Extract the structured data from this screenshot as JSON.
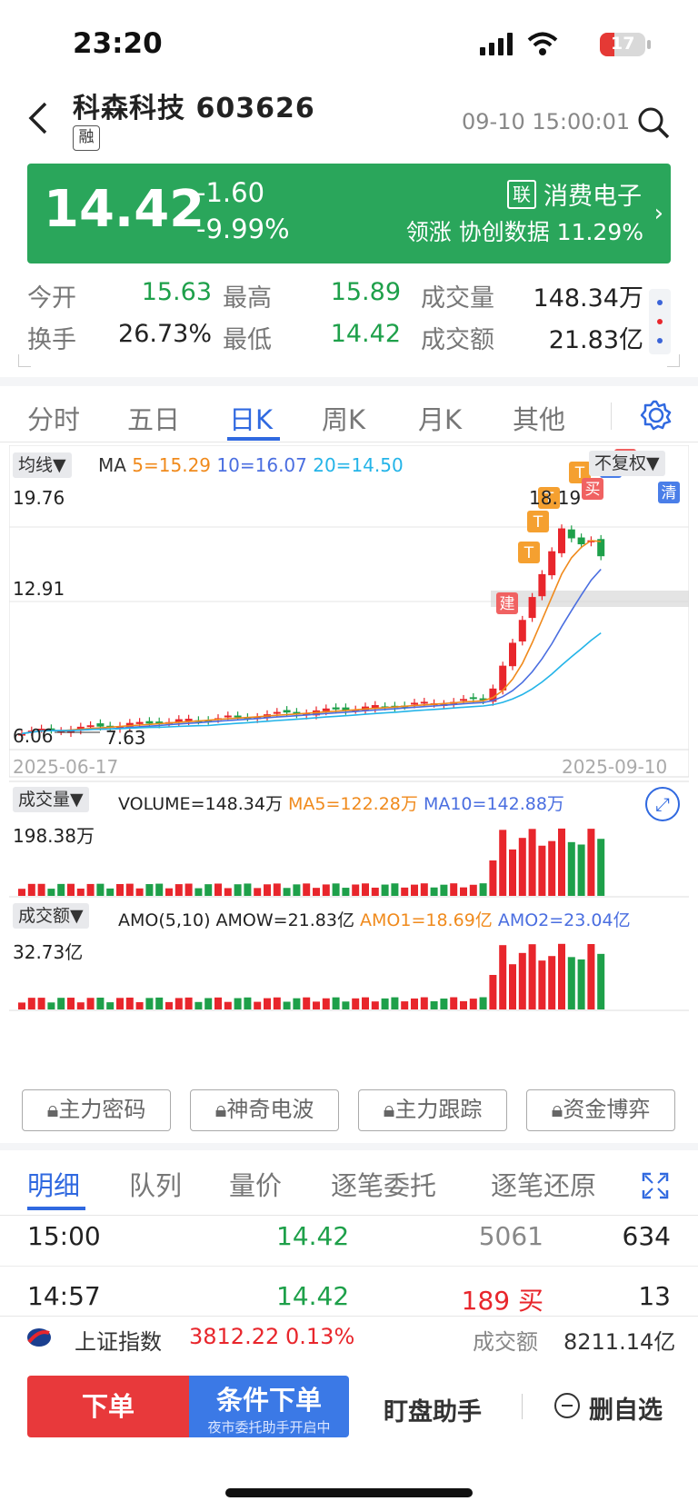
{
  "status": {
    "time": "23:20",
    "battery": "17"
  },
  "header": {
    "stock_name": "科森科技",
    "stock_code": "603626",
    "margin_tag": "融",
    "datetime": "09-10 15:00:01"
  },
  "banner": {
    "price": "14.42",
    "change": "-1.60",
    "change_pct": "-9.99%",
    "linked_tag": "联",
    "sector": "消费电子",
    "lead_label": "领涨",
    "lead_stock": "协创数据",
    "lead_pct": "11.29%",
    "color": "#2aa65b"
  },
  "stats": {
    "open_label": "今开",
    "open": "15.63",
    "high_label": "最高",
    "high": "15.89",
    "volume_label": "成交量",
    "volume": "148.34万",
    "turnover_label": "换手",
    "turnover": "26.73%",
    "low_label": "最低",
    "low": "14.42",
    "amount_label": "成交额",
    "amount": "21.83亿"
  },
  "tabs": [
    "分时",
    "五日",
    "日K",
    "周K",
    "月K",
    "其他"
  ],
  "active_tab": "日K",
  "kchart": {
    "ma_chip": "均线▼",
    "ma_label": "MA",
    "ma5": "5=15.29",
    "ma10": "10=16.07",
    "ma20": "20=14.50",
    "adjust_chip": "不复权▼",
    "y_top": "19.76",
    "y_mid": "12.91",
    "low_label": "6.06",
    "low_label2": "7.63",
    "high_label": "18.19",
    "date_start": "2025-06-17",
    "date_end": "2025-09-10",
    "markers": {
      "build": "建",
      "trade": "T",
      "buy": "买",
      "clear": "清"
    },
    "colors": {
      "up": "#e8262c",
      "down": "#1ea04a",
      "ma5": "#f08a1c",
      "ma10": "#4a6ee0",
      "ma20": "#24b4e8"
    }
  },
  "volume_panel": {
    "chip": "成交量▼",
    "label": "VOLUME=148.34万",
    "ma5": "MA5=122.28万",
    "ma10": "MA10=142.88万",
    "max": "198.38万"
  },
  "amount_panel": {
    "chip": "成交额▼",
    "label": "AMO(5,10)",
    "amow": "AMOW=21.83亿",
    "amo1": "AMO1=18.69亿",
    "amo2": "AMO2=23.04亿",
    "max": "32.73亿"
  },
  "tools": [
    "主力密码",
    "神奇电波",
    "主力跟踪",
    "资金博弈"
  ],
  "detail_tabs": [
    "明细",
    "队列",
    "量价",
    "逐笔委托",
    "逐笔还原"
  ],
  "detail_rows": [
    {
      "time": "15:00",
      "price": "14.42",
      "vol": "5061",
      "vol_color": "gray",
      "count": "634"
    },
    {
      "time": "14:57",
      "price": "14.42",
      "vol": "189 买",
      "vol_color": "red",
      "count": "13"
    }
  ],
  "index_bar": {
    "name": "上证指数",
    "value": "3812.22",
    "pct": "0.13%",
    "amount_label": "成交额",
    "amount": "8211.14亿"
  },
  "bottom": {
    "order": "下单",
    "cond_order": "条件下单",
    "cond_sub": "夜市委托助手开启中",
    "assistant": "盯盘助手",
    "remove": "删自选"
  }
}
